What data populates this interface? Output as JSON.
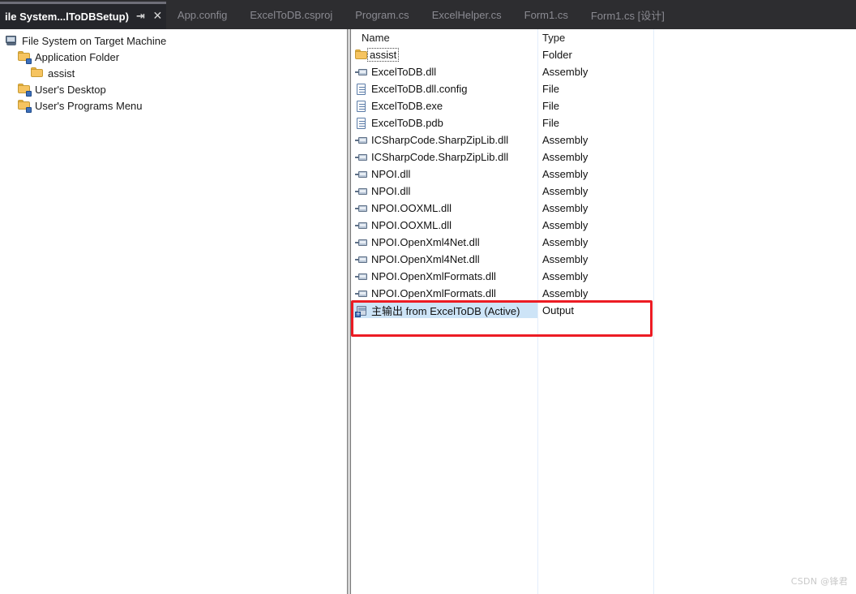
{
  "tabs": [
    {
      "label": "ile System...lToDBSetup)",
      "active": true,
      "pin_icon": "pin-icon",
      "close_icon": "close-icon"
    },
    {
      "label": "App.config",
      "active": false
    },
    {
      "label": "ExcelToDB.csproj",
      "active": false
    },
    {
      "label": "Program.cs",
      "active": false
    },
    {
      "label": "ExcelHelper.cs",
      "active": false
    },
    {
      "label": "Form1.cs",
      "active": false
    },
    {
      "label": "Form1.cs [设计]",
      "active": false
    }
  ],
  "tab_icons": {
    "pin": "⇥",
    "close": "✕"
  },
  "tree": {
    "nodes": [
      {
        "label": "File System on Target Machine",
        "icon": "computer-icon",
        "indent": 0
      },
      {
        "label": "Application Folder",
        "icon": "special-folder-icon",
        "indent": 1
      },
      {
        "label": "assist",
        "icon": "folder-icon",
        "indent": 2
      },
      {
        "label": "User's Desktop",
        "icon": "special-folder-icon",
        "indent": 1
      },
      {
        "label": "User's Programs Menu",
        "icon": "special-folder-icon",
        "indent": 1
      }
    ]
  },
  "list": {
    "columns": [
      "Name",
      "Type"
    ],
    "rows": [
      {
        "name": "assist",
        "type": "Folder",
        "icon": "folder-icon",
        "focused": true,
        "selected": false
      },
      {
        "name": "ExcelToDB.dll",
        "type": "Assembly",
        "icon": "assembly-icon",
        "focused": false,
        "selected": false
      },
      {
        "name": "ExcelToDB.dll.config",
        "type": "File",
        "icon": "file-icon",
        "focused": false,
        "selected": false
      },
      {
        "name": "ExcelToDB.exe",
        "type": "File",
        "icon": "file-icon",
        "focused": false,
        "selected": false
      },
      {
        "name": "ExcelToDB.pdb",
        "type": "File",
        "icon": "file-icon",
        "focused": false,
        "selected": false
      },
      {
        "name": "ICSharpCode.SharpZipLib.dll",
        "type": "Assembly",
        "icon": "assembly-icon",
        "focused": false,
        "selected": false
      },
      {
        "name": "ICSharpCode.SharpZipLib.dll",
        "type": "Assembly",
        "icon": "assembly-icon",
        "focused": false,
        "selected": false
      },
      {
        "name": "NPOI.dll",
        "type": "Assembly",
        "icon": "assembly-icon",
        "focused": false,
        "selected": false
      },
      {
        "name": "NPOI.dll",
        "type": "Assembly",
        "icon": "assembly-icon",
        "focused": false,
        "selected": false
      },
      {
        "name": "NPOI.OOXML.dll",
        "type": "Assembly",
        "icon": "assembly-icon",
        "focused": false,
        "selected": false
      },
      {
        "name": "NPOI.OOXML.dll",
        "type": "Assembly",
        "icon": "assembly-icon",
        "focused": false,
        "selected": false
      },
      {
        "name": "NPOI.OpenXml4Net.dll",
        "type": "Assembly",
        "icon": "assembly-icon",
        "focused": false,
        "selected": false
      },
      {
        "name": "NPOI.OpenXml4Net.dll",
        "type": "Assembly",
        "icon": "assembly-icon",
        "focused": false,
        "selected": false
      },
      {
        "name": "NPOI.OpenXmlFormats.dll",
        "type": "Assembly",
        "icon": "assembly-icon",
        "focused": false,
        "selected": false
      },
      {
        "name": "NPOI.OpenXmlFormats.dll",
        "type": "Assembly",
        "icon": "assembly-icon",
        "focused": false,
        "selected": false
      },
      {
        "name": "主输出 from ExcelToDB (Active)",
        "type": "Output",
        "icon": "output-icon",
        "focused": false,
        "selected": true
      }
    ]
  },
  "annotation": {
    "color": "#ec1c24"
  },
  "watermark": {
    "text": "CSDN @锋君"
  },
  "colors": {
    "tabstrip_bg": "#2d2d30",
    "active_tab_bg": "#25262b",
    "selection": "#cde4f7",
    "column_divider": "#e3eefb"
  }
}
